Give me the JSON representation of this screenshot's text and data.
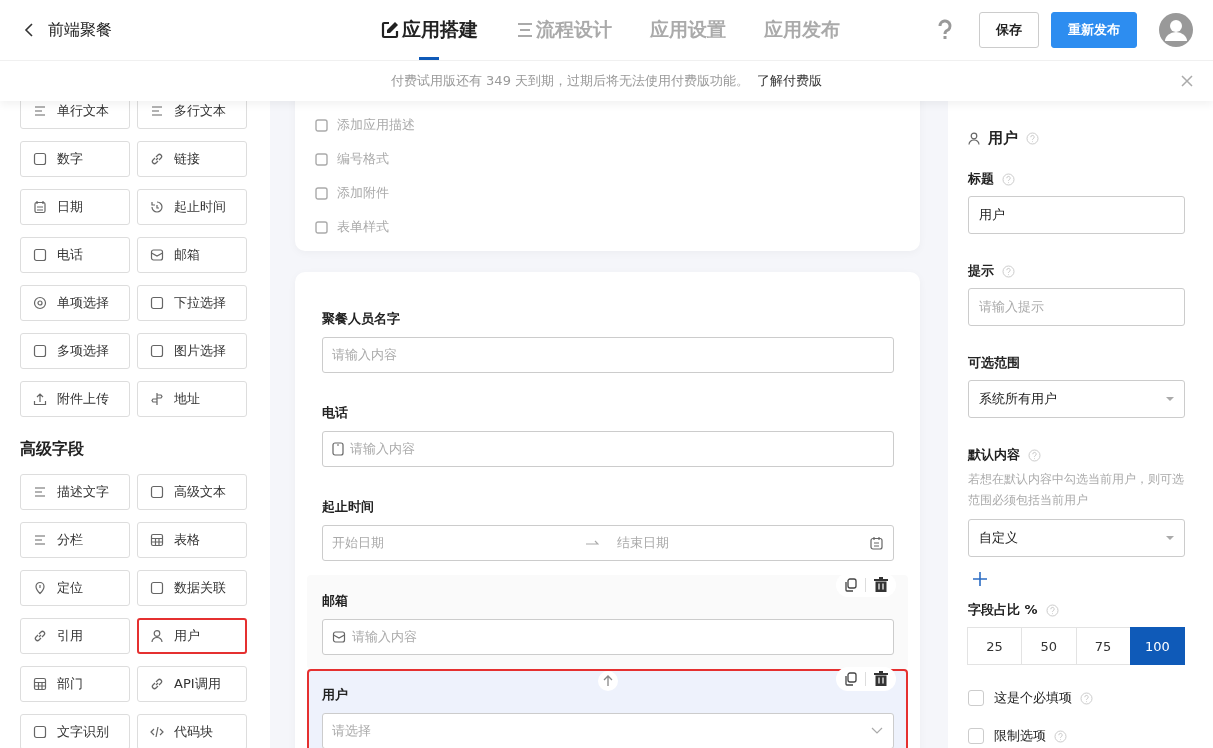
{
  "header": {
    "back_title": "前端聚餐",
    "tabs": [
      {
        "label": "应用搭建",
        "selected": true
      },
      {
        "label": "流程设计",
        "selected": false
      },
      {
        "label": "应用设置",
        "selected": false
      },
      {
        "label": "应用发布",
        "selected": false
      }
    ],
    "buttons": [
      {
        "label": "保存",
        "kind": "default"
      },
      {
        "label": "重新发布",
        "kind": "primary"
      }
    ]
  },
  "banner": {
    "text": "付费试用版还有 349 天到期，过期后将无法使用付费版功能。",
    "link": "了解付费版"
  },
  "palette": {
    "basic_fields": [
      {
        "label": "单行文本",
        "highlighted": false
      },
      {
        "label": "多行文本",
        "highlighted": false
      },
      {
        "label": "数字",
        "highlighted": false
      },
      {
        "label": "链接",
        "highlighted": false
      },
      {
        "label": "日期",
        "highlighted": false
      },
      {
        "label": "起止时间",
        "highlighted": false
      },
      {
        "label": "电话",
        "highlighted": false
      },
      {
        "label": "邮箱",
        "highlighted": false
      },
      {
        "label": "单项选择",
        "highlighted": false
      },
      {
        "label": "下拉选择",
        "highlighted": false
      },
      {
        "label": "多项选择",
        "highlighted": false
      },
      {
        "label": "图片选择",
        "highlighted": false
      },
      {
        "label": "附件上传",
        "highlighted": false
      },
      {
        "label": "地址",
        "highlighted": false
      }
    ],
    "advanced_title": "高级字段",
    "advanced_fields": [
      {
        "label": "描述文字",
        "highlighted": false
      },
      {
        "label": "高级文本",
        "highlighted": false
      },
      {
        "label": "分栏",
        "highlighted": false
      },
      {
        "label": "表格",
        "highlighted": false
      },
      {
        "label": "定位",
        "highlighted": false
      },
      {
        "label": "数据关联",
        "highlighted": false
      },
      {
        "label": "引用",
        "highlighted": false
      },
      {
        "label": "用户",
        "highlighted": true
      },
      {
        "label": "部门",
        "highlighted": false
      },
      {
        "label": "API调用",
        "highlighted": false
      },
      {
        "label": "文字识别",
        "highlighted": false
      },
      {
        "label": "代码块",
        "highlighted": false
      }
    ]
  },
  "form_settings": [
    "添加应用描述",
    "编号格式",
    "添加附件",
    "表单样式"
  ],
  "form_fields": [
    {
      "label": "聚餐人员名字",
      "kind": "text",
      "placeholder": "请输入内容",
      "selected": false,
      "show_actions": false
    },
    {
      "label": "电话",
      "kind": "phone",
      "placeholder": "请输入内容",
      "selected": false,
      "show_actions": false
    },
    {
      "label": "起止时间",
      "kind": "daterange",
      "placeholder": "开始日期",
      "placeholder_end": "结束日期",
      "selected": false,
      "show_actions": false
    },
    {
      "label": "邮箱",
      "kind": "email",
      "placeholder": "请输入内容",
      "selected": false,
      "show_actions": true
    },
    {
      "label": "用户",
      "kind": "select",
      "placeholder": "请选择",
      "selected": true,
      "show_actions": true
    }
  ],
  "properties": {
    "field_type": "用户",
    "title_label": "标题",
    "title_value": "用户",
    "hint_label": "提示",
    "hint_placeholder": "请输入提示",
    "range_label": "可选范围",
    "range_value": "系统所有用户",
    "default_label": "默认内容",
    "default_note": "若想在默认内容中勾选当前用户，则可选范围必须包括当前用户",
    "default_value": "自定义",
    "width_label": "字段占比 %",
    "width_options": [
      {
        "label": "25",
        "selected": false
      },
      {
        "label": "50",
        "selected": false
      },
      {
        "label": "75",
        "selected": false
      },
      {
        "label": "100",
        "selected": true
      }
    ],
    "checkboxes": [
      {
        "label": "这是个必填项",
        "checked": false
      },
      {
        "label": "限制选项",
        "checked": false
      }
    ]
  }
}
